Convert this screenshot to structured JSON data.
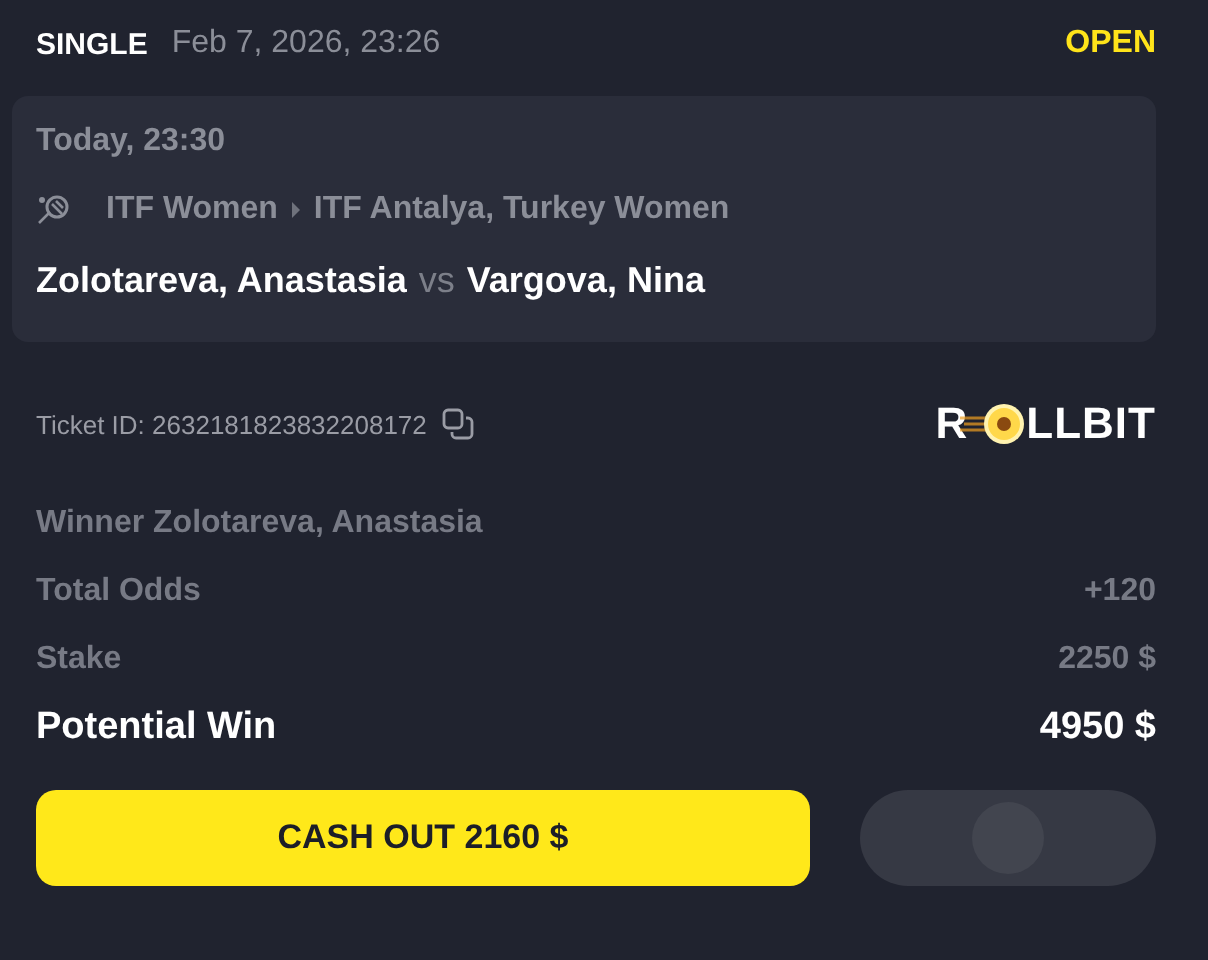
{
  "header": {
    "type": "SINGLE",
    "placed": "Feb 7, 2026, 23:26",
    "status": "OPEN"
  },
  "event": {
    "time": "Today, 23:30",
    "breadcrumb": [
      "ITF Women",
      "ITF Antalya, Turkey Women"
    ],
    "home": "Zolotareva, Anastasia",
    "vs": "vs",
    "away": "Vargova, Nina"
  },
  "ticket": {
    "label": "Ticket ID: 2632181823832208172"
  },
  "logo": {
    "before": "R",
    "after": "LLBIT"
  },
  "selection": "Winner Zolotareva, Anastasia",
  "rows": [
    {
      "label": "Total Odds",
      "value": "+120",
      "emphasis": false
    },
    {
      "label": "Stake",
      "value": "2250 $",
      "emphasis": false
    },
    {
      "label": "Potential Win",
      "value": "4950 $",
      "emphasis": true
    }
  ],
  "cashout": {
    "label": "CASH OUT 2160 $"
  }
}
